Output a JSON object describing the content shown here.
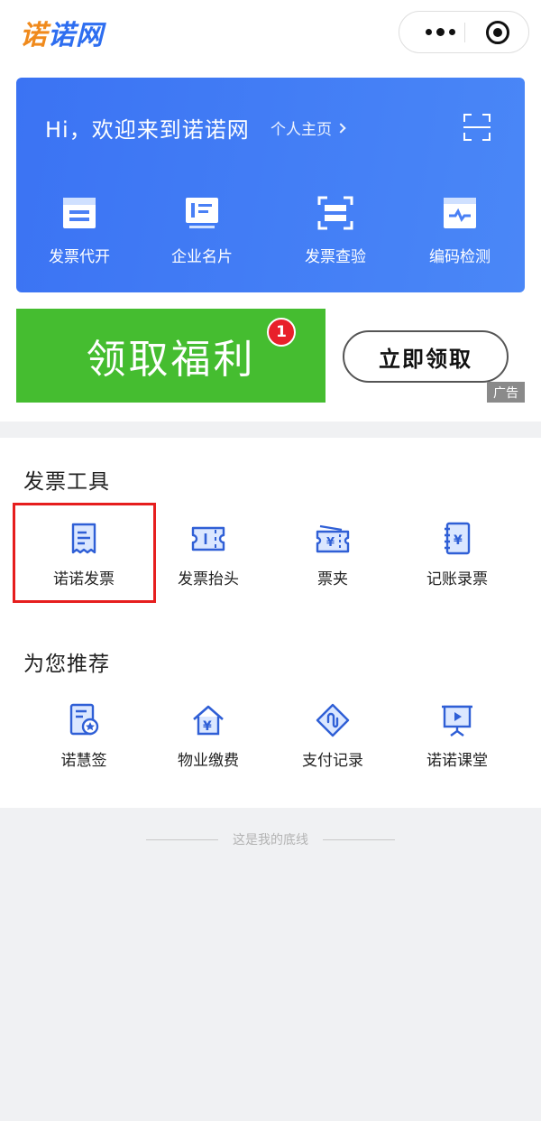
{
  "app": {
    "logo_part1": "诺",
    "logo_part2": "诺网"
  },
  "card": {
    "greeting": "Hi，欢迎来到诺诺网",
    "profile_link": "个人主页",
    "actions": [
      {
        "label": "发票代开",
        "icon": "invoice-issue-icon"
      },
      {
        "label": "企业名片",
        "icon": "business-card-icon"
      },
      {
        "label": "发票查验",
        "icon": "invoice-check-icon"
      },
      {
        "label": "编码检测",
        "icon": "code-detect-icon"
      }
    ]
  },
  "ad": {
    "banner_text": "领取福利",
    "badge_count": "1",
    "button_label": "立即领取",
    "tag": "广告"
  },
  "invoice_tools": {
    "title": "发票工具",
    "items": [
      {
        "label": "诺诺发票",
        "icon": "receipt-icon"
      },
      {
        "label": "发票抬头",
        "icon": "ticket-icon"
      },
      {
        "label": "票夹",
        "icon": "ticket-folder-icon"
      },
      {
        "label": "记账录票",
        "icon": "ledger-icon"
      }
    ]
  },
  "recommend": {
    "title": "为您推荐",
    "items": [
      {
        "label": "诺慧签",
        "icon": "sign-doc-icon"
      },
      {
        "label": "物业缴费",
        "icon": "property-fee-icon"
      },
      {
        "label": "支付记录",
        "icon": "payment-record-icon"
      },
      {
        "label": "诺诺课堂",
        "icon": "classroom-icon"
      }
    ]
  },
  "footer": {
    "end_text": "这是我的底线"
  },
  "colors": {
    "brand_blue": "#3b73f3",
    "brand_orange": "#f08a1c",
    "ad_green": "#45bd30",
    "badge_red": "#e8202a",
    "highlight_red": "#e61e1e"
  }
}
